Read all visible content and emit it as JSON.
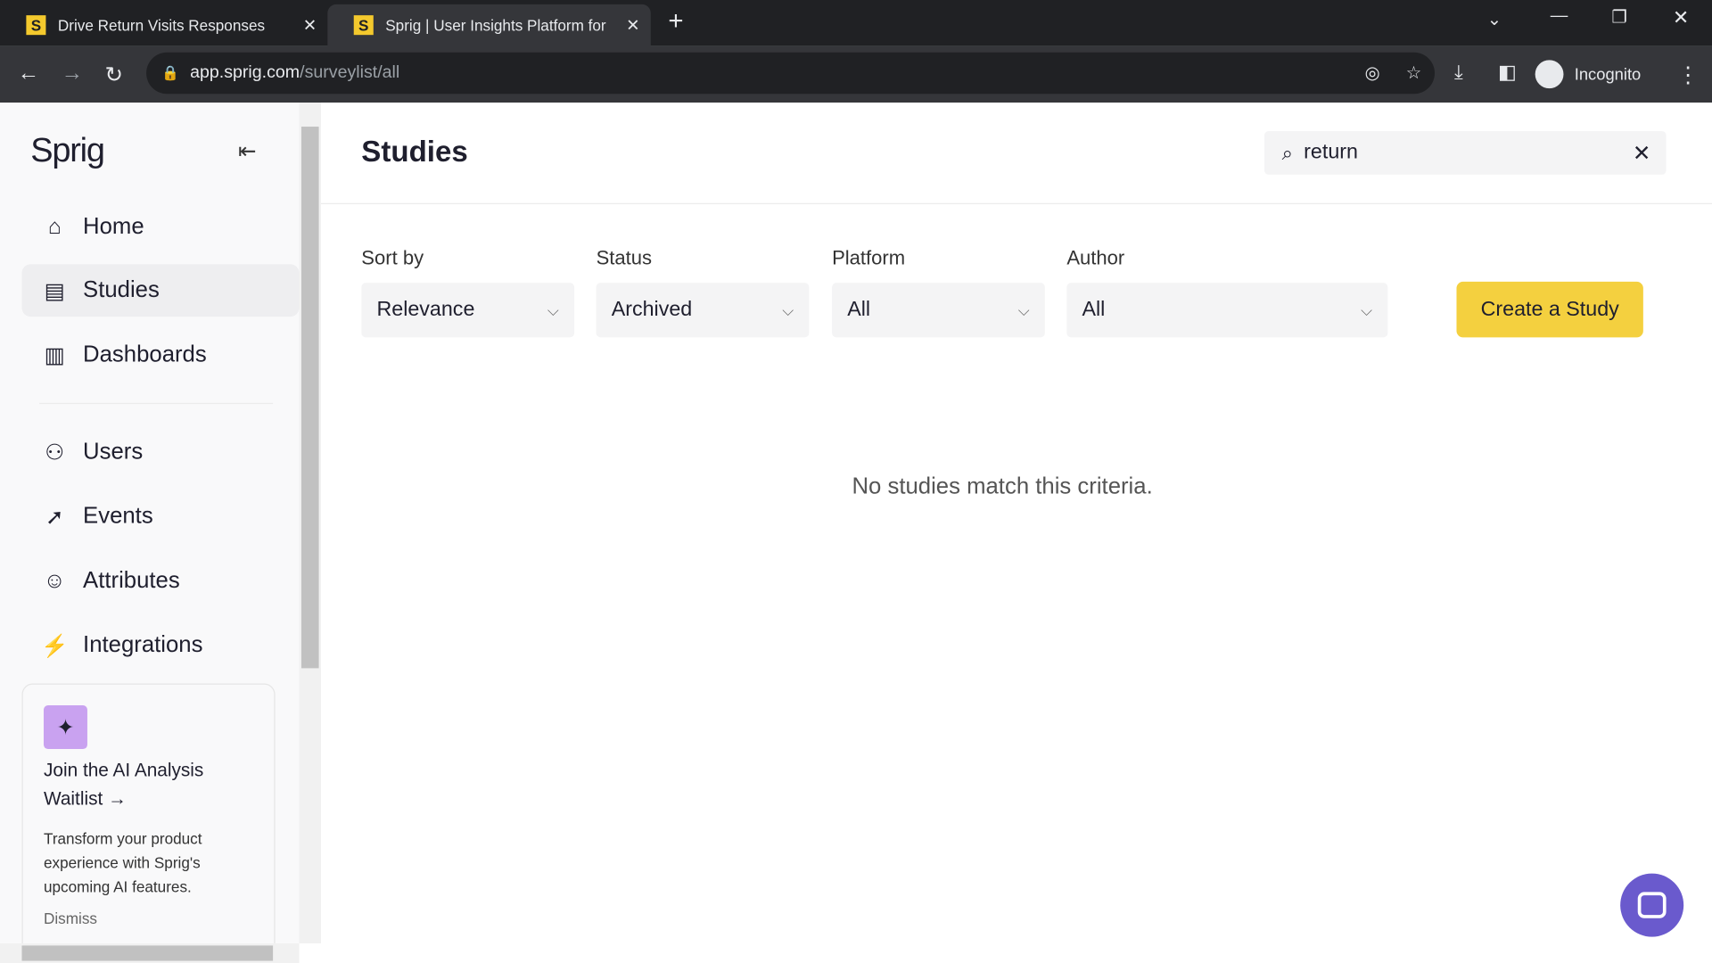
{
  "browser": {
    "tabs": [
      {
        "title": "Drive Return Visits Responses",
        "favicon": "S"
      },
      {
        "title": "Sprig | User Insights Platform for",
        "favicon": "S"
      }
    ],
    "url_host": "app.sprig.com",
    "url_path": "/surveylist/all",
    "profile": "Incognito"
  },
  "sidebar": {
    "logo": "Sprig",
    "items": [
      {
        "label": "Home",
        "icon": "home-icon"
      },
      {
        "label": "Studies",
        "icon": "studies-icon"
      },
      {
        "label": "Dashboards",
        "icon": "dashboards-icon"
      },
      {
        "label": "Users",
        "icon": "users-icon"
      },
      {
        "label": "Events",
        "icon": "events-icon"
      },
      {
        "label": "Attributes",
        "icon": "attributes-icon"
      },
      {
        "label": "Integrations",
        "icon": "integrations-icon"
      }
    ],
    "active": "Studies",
    "promo": {
      "title": "Join the AI Analysis Waitlist →",
      "body": "Transform your product experience with Sprig's upcoming AI features.",
      "dismiss": "Dismiss"
    }
  },
  "main": {
    "title": "Studies",
    "search_value": "return",
    "filters": [
      {
        "label": "Sort by",
        "value": "Relevance"
      },
      {
        "label": "Status",
        "value": "Archived"
      },
      {
        "label": "Platform",
        "value": "All"
      },
      {
        "label": "Author",
        "value": "All"
      }
    ],
    "create_button": "Create a Study",
    "empty_message": "No studies match this criteria."
  },
  "colors": {
    "accent": "#f4d03f",
    "chat": "#6a5acd",
    "promo_icon": "#c9a2f0"
  }
}
